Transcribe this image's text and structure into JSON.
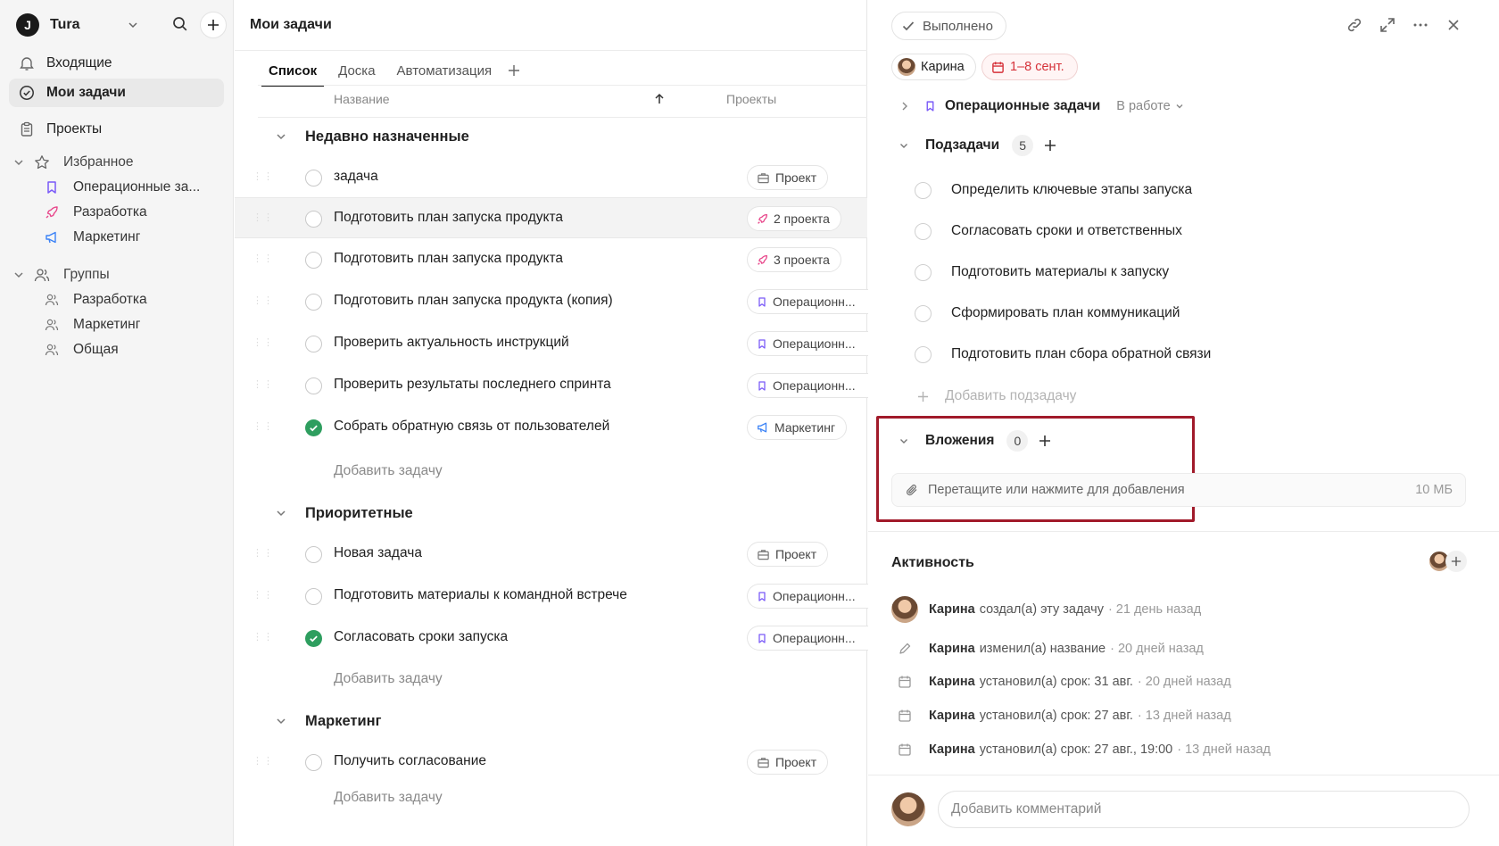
{
  "workspace": {
    "logo": "J",
    "name": "Tura"
  },
  "sidebar": {
    "inbox": "Входящие",
    "my_tasks": "Мои задачи",
    "projects": "Проекты",
    "favorites": {
      "label": "Избранное",
      "items": [
        "Операционные за...",
        "Разработка",
        "Маркетинг"
      ]
    },
    "groups": {
      "label": "Группы",
      "items": [
        "Разработка",
        "Маркетинг",
        "Общая"
      ]
    }
  },
  "main": {
    "title": "Мои задачи",
    "tabs": [
      "Список",
      "Доска",
      "Автоматизация"
    ],
    "columns": {
      "name": "Название",
      "projects": "Проекты"
    },
    "add_task": "Добавить задачу",
    "groups": [
      {
        "title": "Недавно назначенные",
        "tasks": [
          {
            "title": "задача",
            "done": false,
            "project": "Проект",
            "project_icon": "briefcase-icon"
          },
          {
            "title": "Подготовить план запуска продукта",
            "done": false,
            "project": "2 проекта",
            "project_icon": "rocket-icon"
          },
          {
            "title": "Подготовить план запуска продукта",
            "done": false,
            "project": "3 проекта",
            "project_icon": "rocket-icon"
          },
          {
            "title": "Подготовить план запуска продукта (копия)",
            "done": false,
            "project": "Операционн...",
            "project_icon": "bookmark-icon"
          },
          {
            "title": "Проверить актуальность инструкций",
            "done": false,
            "project": "Операционн...",
            "project_icon": "bookmark-icon"
          },
          {
            "title": "Проверить результаты последнего спринта",
            "done": false,
            "project": "Операционн...",
            "project_icon": "bookmark-icon"
          },
          {
            "title": "Собрать обратную связь от пользователей",
            "done": true,
            "project": "Маркетинг",
            "project_icon": "megaphone-icon"
          }
        ]
      },
      {
        "title": "Приоритетные",
        "tasks": [
          {
            "title": "Новая задача",
            "done": false,
            "project": "Проект",
            "project_icon": "briefcase-icon"
          },
          {
            "title": "Подготовить материалы к командной встрече",
            "done": false,
            "project": "Операционн...",
            "project_icon": "bookmark-icon"
          },
          {
            "title": "Согласовать сроки запуска",
            "done": true,
            "project": "Операционн...",
            "project_icon": "bookmark-icon"
          }
        ]
      },
      {
        "title": "Маркетинг",
        "tasks": [
          {
            "title": "Получить согласование",
            "done": false,
            "project": "Проект",
            "project_icon": "briefcase-icon"
          }
        ]
      }
    ]
  },
  "panel": {
    "done_label": "Выполнено",
    "assignee": "Карина",
    "dates": "1–8 сент.",
    "project": "Операционные задачи",
    "status": "В работе",
    "subtasks": {
      "label": "Подзадачи",
      "count": "5",
      "items": [
        "Определить ключевые этапы запуска",
        "Согласовать сроки и ответственных",
        "Подготовить материалы к запуску",
        "Сформировать план коммуникаций",
        "Подготовить план сбора обратной связи"
      ],
      "add_label": "Добавить подзадачу"
    },
    "attachments": {
      "label": "Вложения",
      "count": "0",
      "drop_text": "Перетащите или нажмите для добавления",
      "size_limit": "10 МБ"
    },
    "activity": {
      "title": "Активность",
      "items": [
        {
          "who": "Карина",
          "what": "создал(а) эту задачу",
          "when": "· 21 день назад",
          "icon": "avatar"
        },
        {
          "who": "Карина",
          "what": "изменил(а) название",
          "when": "· 20 дней назад",
          "icon": "pencil-icon"
        },
        {
          "who": "Карина",
          "what": "установил(а) срок: 31 авг.",
          "when": "· 20 дней назад",
          "icon": "calendar-icon"
        },
        {
          "who": "Карина",
          "what": "установил(а) срок: 27 авг.",
          "when": "· 13 дней назад",
          "icon": "calendar-icon"
        },
        {
          "who": "Карина",
          "what": "установил(а) срок: 27 авг., 19:00",
          "when": "· 13 дней назад",
          "icon": "calendar-icon"
        }
      ]
    },
    "comment_placeholder": "Добавить комментарий"
  },
  "colors": {
    "done_green": "#2e9e5f",
    "date_red": "#d6323a",
    "highlight_border": "#a11a2a"
  }
}
